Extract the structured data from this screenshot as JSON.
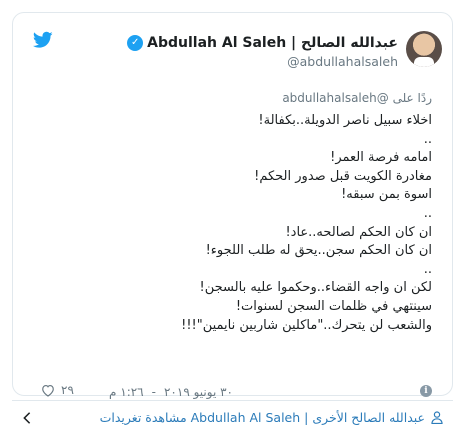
{
  "author": {
    "name": "Abdullah Al Saleh | عبدالله الصالح",
    "handle": "@abdullahalsaleh",
    "verified_mark": "✓"
  },
  "icons": {
    "brand": "twitter-bird-icon",
    "verified": "verified-badge-icon",
    "like": "heart-icon",
    "info": "info-icon",
    "profile": "person-icon",
    "nav": "chevron-left-icon"
  },
  "colors": {
    "brand": "#1da1f2",
    "link": "#2b7bb9",
    "muted": "#697882"
  },
  "tweet": {
    "reply_to": "ردًا على @abdullahalsaleh",
    "lines": [
      "اخلاء سبيل ناصر الدويلة..بكفالة!",
      "..",
      "امامه فرصة العمر!",
      "مغادرة الكويت قبل صدور الحكم!",
      "اسوة بمن سبقه!",
      "..",
      "ان كان الحكم لصالحه..عاد!",
      "ان كان الحكم سجن..يحق له طلب اللجوء!",
      "..",
      "لكن ان واجه القضاء..وحكموا عليه بالسجن!",
      "سينتهي في ظلمات السجن لسنوات!",
      "والشعب لن يتحرك..\"ماكلين شاربين نايمين\"!!!"
    ],
    "likes": "٢٩",
    "time": "١:٢٦ م",
    "separator": "-",
    "date": "٣٠ يونيو ٢٠١٩",
    "info_mark": "i"
  },
  "more": {
    "label": "مشاهدة تغريدات Abdullah Al Saleh | عبدالله الصالح الأخرى"
  }
}
